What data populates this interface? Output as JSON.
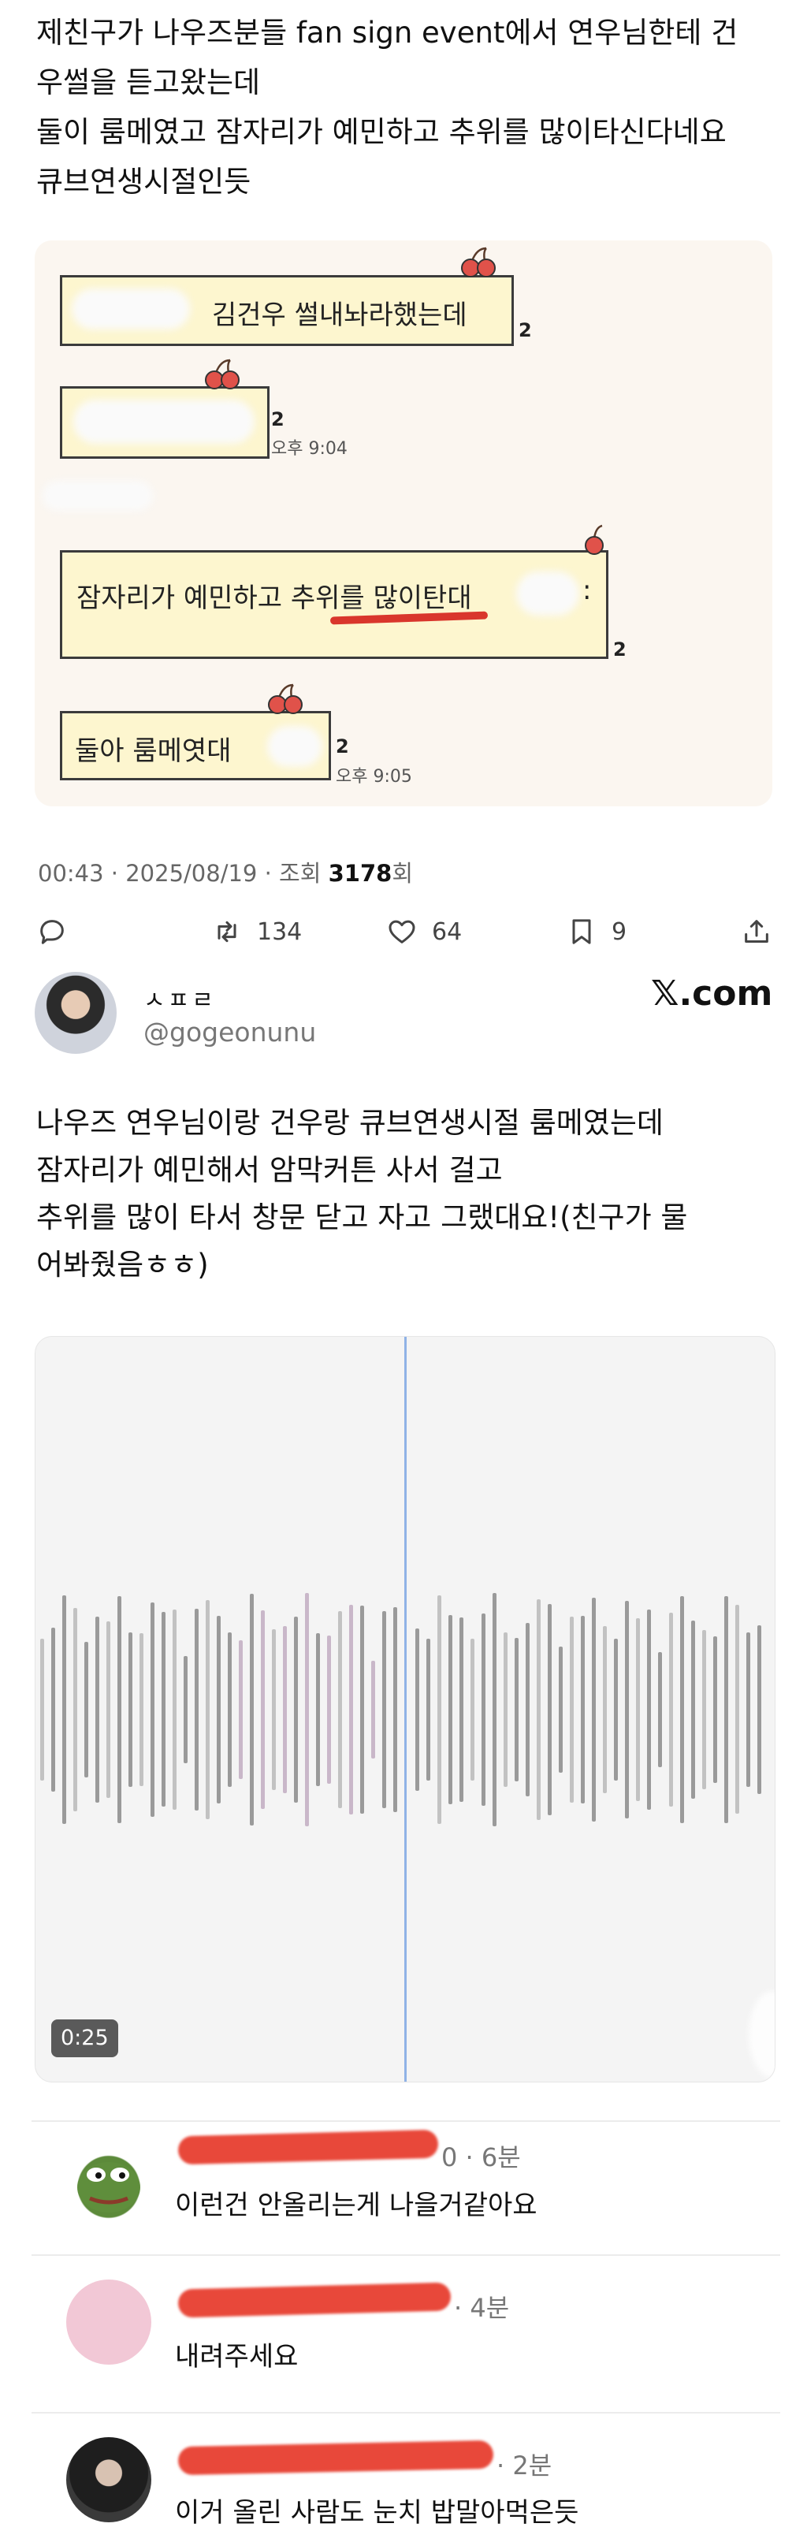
{
  "tweet": {
    "text": "제친구가 나우즈분들 fan sign event에서 연우님한테 건\n우썰을 듣고왔는데\n둘이 룸메였고 잠자리가 예민하고 추위를 많이타신다네요\n큐브연생시절인듯"
  },
  "chat": {
    "bubble1_text": "김건우 썰내놔라했는데",
    "bubble1_count": "2",
    "bubble2_count": "2",
    "bubble2_time": "오후 9:04",
    "bubble3_text": "잠자리가 예민하고 추위를 많이탄대",
    "bubble3_suffix": ":",
    "bubble3_count": "2",
    "bubble4_text": "둘아 룸메엿대",
    "bubble4_count": "2",
    "bubble4_time": "오후 9:05"
  },
  "meta": {
    "time_date": "00:43 · 2025/08/19 · 조회 ",
    "views": "3178",
    "views_suffix": "회"
  },
  "actions": {
    "retweets": "134",
    "likes": "64",
    "bookmarks": "9"
  },
  "quoted": {
    "name": "ㅅㅍㄹ",
    "handle": "@gogeonunu",
    "source": "𝕏.com",
    "text": "나우즈 연우님이랑 건우랑 큐브연생시절 룸메였는데\n잠자리가 예민해서 암막커튼 사서 걸고\n추위를 많이 타서 창문 닫고 자고 그랬대요!(친구가 물\n어봐줬음ㅎㅎ)",
    "duration": "0:25"
  },
  "comments": [
    {
      "meta": "0 · 6분",
      "text": "이런건 안올리는게 나을거같아요"
    },
    {
      "meta": "· 4분",
      "text": "내려주세요"
    },
    {
      "meta": "· 2분",
      "text": "이거 올린 사람도 눈치 밥말아먹은듯"
    }
  ],
  "icons": {
    "reply": "reply-icon",
    "retweet": "retweet-icon",
    "like": "heart-icon",
    "bookmark": "bookmark-icon",
    "share": "share-icon"
  },
  "colors": {
    "bubble": "#fdf6cf",
    "chat_bg": "#fbf6f0",
    "redact": "#e8483a",
    "playhead": "#8fb2e6"
  }
}
